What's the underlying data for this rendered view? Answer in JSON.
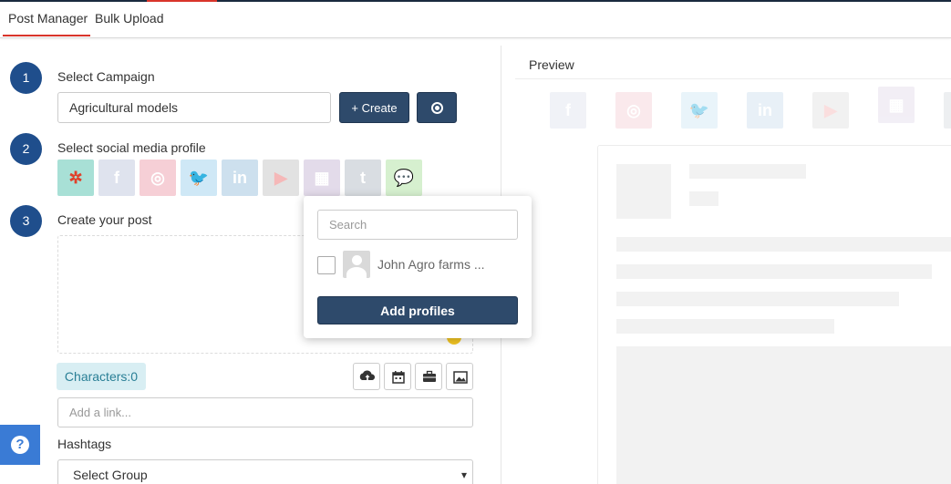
{
  "tabs": [
    {
      "label": "Post Manager",
      "active": true
    },
    {
      "label": "Bulk Upload",
      "active": false
    }
  ],
  "steps": {
    "step1": {
      "number": "1",
      "label": "Select Campaign"
    },
    "step2": {
      "number": "2",
      "label": "Select social media profile"
    },
    "step3": {
      "number": "3",
      "label": "Create your post"
    }
  },
  "campaign": {
    "value": "Agricultural models",
    "create_label": "+ Create"
  },
  "social_profiles": [
    {
      "name": "brand-icon",
      "glyph": "✲",
      "bg": "#a8e0d6",
      "fg": "#e0402a"
    },
    {
      "name": "facebook-icon",
      "glyph": "f",
      "bg": "#dfe3ee",
      "fg": "#ffffff"
    },
    {
      "name": "instagram-icon",
      "glyph": "◎",
      "bg": "#f6cfd6",
      "fg": "#ffffff"
    },
    {
      "name": "twitter-icon",
      "glyph": "🐦",
      "bg": "#cfe8f6",
      "fg": "#ffffff"
    },
    {
      "name": "linkedin-icon",
      "glyph": "in",
      "bg": "#cde0ee",
      "fg": "#ffffff"
    },
    {
      "name": "youtube-icon",
      "glyph": "▶",
      "bg": "#e2e2e2",
      "fg": "#f5b8b8"
    },
    {
      "name": "google-business-icon",
      "glyph": "▦",
      "bg": "#e3dbea",
      "fg": "#ffffff"
    },
    {
      "name": "tumblr-icon",
      "glyph": "t",
      "bg": "#d9dde2",
      "fg": "#ffffff"
    },
    {
      "name": "wechat-icon",
      "glyph": "💬",
      "bg": "#d6f0cf",
      "fg": "#ffffff"
    }
  ],
  "post": {
    "characters_label": "Characters:0",
    "link_placeholder": "Add a link..."
  },
  "toolbar": [
    "cloud-upload-icon",
    "calendar-icon",
    "briefcase-icon",
    "image-icon"
  ],
  "hashtags": {
    "label": "Hashtags",
    "select_value": "Select Group"
  },
  "help": {
    "glyph": "?"
  },
  "preview": {
    "title": "Preview"
  },
  "popup": {
    "search_placeholder": "Search",
    "profile_name": "John Agro farms ...",
    "add_label": "Add profiles"
  }
}
